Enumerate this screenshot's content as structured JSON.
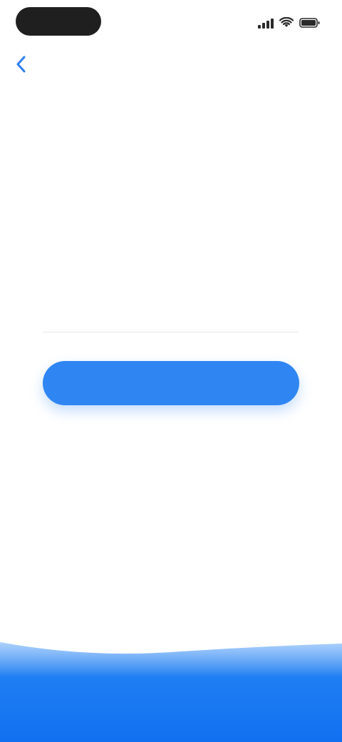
{
  "status_bar": {
    "time": "",
    "icons": [
      "signal-icon",
      "wifi-icon",
      "battery-icon"
    ]
  },
  "back": {
    "icon": "back-arrow-icon"
  },
  "main": {
    "title": "",
    "subtitle": "",
    "code_input": {
      "value": "",
      "placeholder": ""
    },
    "primary_button_label": "",
    "hint": "",
    "resend_label": ""
  },
  "colors": {
    "accent": "#2f86f3",
    "background": "#ffffff",
    "status_pill": "#1f1f1f",
    "wave": "#1477f2"
  }
}
